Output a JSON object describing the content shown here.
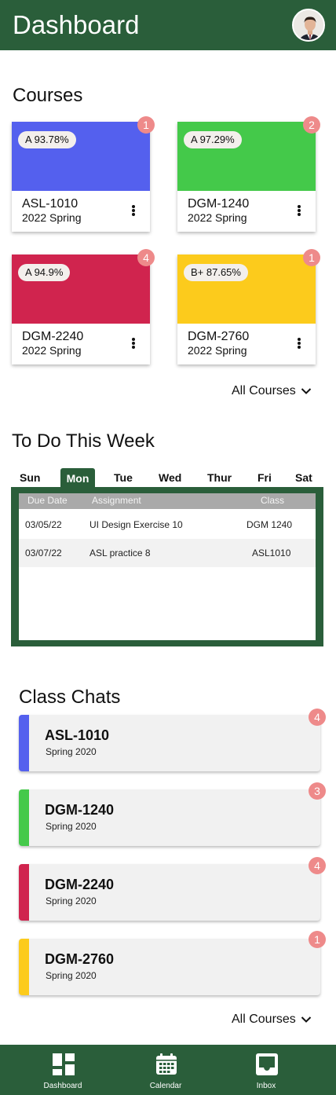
{
  "header": {
    "title": "Dashboard"
  },
  "courses": {
    "title": "Courses",
    "items": [
      {
        "grade": "A 93.78%",
        "code": "ASL-1010",
        "term": "2022 Spring",
        "badge": "1",
        "color": "#5460ee"
      },
      {
        "grade": "A 97.29%",
        "code": "DGM-1240",
        "term": "2022 Spring",
        "badge": "2",
        "color": "#44c94a"
      },
      {
        "grade": "A 94.9%",
        "code": "DGM-2240",
        "term": "2022 Spring",
        "badge": "4",
        "color": "#d0244e"
      },
      {
        "grade": "B+ 87.65%",
        "code": "DGM-2760",
        "term": "2022 Spring",
        "badge": "1",
        "color": "#fccb1c"
      }
    ],
    "all_label": "All Courses"
  },
  "todo": {
    "title": "To Do This Week",
    "days": [
      "Sun",
      "Mon",
      "Tue",
      "Wed",
      "Thur",
      "Fri",
      "Sat"
    ],
    "active_day": "Mon",
    "columns": [
      "Due Date",
      "Assignment",
      "Class"
    ],
    "rows": [
      {
        "date": "03/05/22",
        "assignment": "UI Design Exercise 10",
        "class": "DGM 1240"
      },
      {
        "date": "03/07/22",
        "assignment": "ASL practice 8",
        "class": "ASL1010"
      }
    ]
  },
  "chats": {
    "title": "Class Chats",
    "items": [
      {
        "code": "ASL-1010",
        "term": "Spring 2020",
        "badge": "4",
        "color": "#5460ee"
      },
      {
        "code": "DGM-1240",
        "term": "Spring 2020",
        "badge": "3",
        "color": "#44c94a"
      },
      {
        "code": "DGM-2240",
        "term": "Spring 2020",
        "badge": "4",
        "color": "#d0244e"
      },
      {
        "code": "DGM-2760",
        "term": "Spring 2020",
        "badge": "1",
        "color": "#fccb1c"
      }
    ],
    "all_label": "All Courses"
  },
  "nav": {
    "items": [
      {
        "label": "Dashboard",
        "icon": "dashboard-icon"
      },
      {
        "label": "Calendar",
        "icon": "calendar-icon"
      },
      {
        "label": "Inbox",
        "icon": "inbox-icon"
      }
    ]
  },
  "colors": {
    "brand": "#2a5e3a",
    "badge": "#ee8a8a"
  }
}
